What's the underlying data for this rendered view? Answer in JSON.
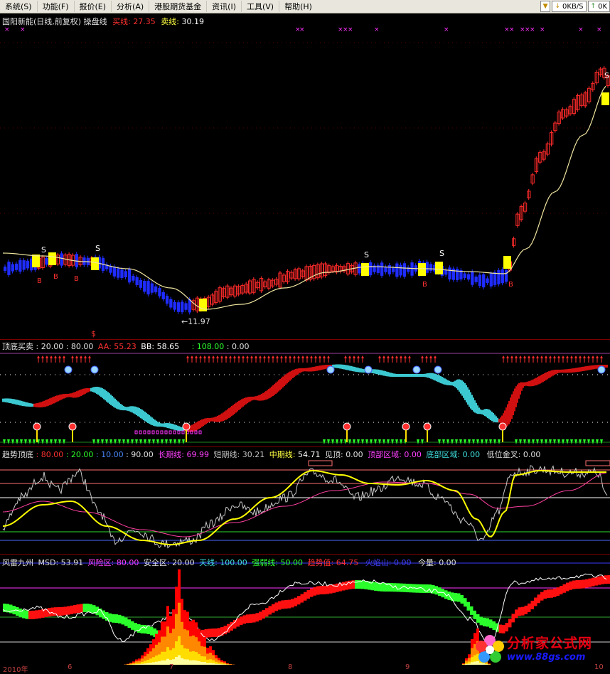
{
  "menu": {
    "items": [
      "系统(S)",
      "功能(F)",
      "报价(E)",
      "分析(A)",
      "港股期货基金",
      "资讯(I)",
      "工具(V)",
      "帮助(H)"
    ],
    "speed_up": "0KB/S",
    "speed_down": "0K",
    "tray_text": "↓"
  },
  "panel1": {
    "stock": "国阳新能(日线,前复权)",
    "indicator": "操盘线",
    "buy_label": "买线:",
    "buy_value": "27.35",
    "sell_label": "卖线:",
    "sell_value": "30.19",
    "low_marker": "←11.97",
    "s_mark": "S",
    "b_mark": "B",
    "cash_mark": "$"
  },
  "panel2": {
    "name": "顶底买卖",
    "v1": ": 20.00",
    "v2": ": 80.00",
    "aa_label": "AA:",
    "aa_value": "55.23",
    "bb_label": "BB:",
    "bb_value": "58.65",
    "v3": ": 108.00",
    "v4": ": 0.00"
  },
  "panel3": {
    "name": "趋势顶底",
    "v1": ": 80.00",
    "v2": ": 20.00",
    "v3": ": 10.00",
    "v4": ": 90.00",
    "long_label": "长期线:",
    "long_value": "69.99",
    "short_label": "短期线:",
    "short_value": "30.21",
    "mid_label": "中期线:",
    "mid_value": "54.71",
    "top_label": "见顶:",
    "top_value": "0.00",
    "topzone_label": "顶部区域:",
    "topzone_value": "0.00",
    "botzone_label": "底部区域:",
    "botzone_value": "0.00",
    "gold_label": "低位金叉:",
    "gold_value": "0.00"
  },
  "panel4": {
    "name": "风雷九州",
    "msd_label": "MSD:",
    "msd_value": "53.91",
    "risk_label": "风险区:",
    "risk_value": "80.00",
    "safe_label": "安全区:",
    "safe_value": "20.00",
    "sky_label": "天线:",
    "sky_value": "100.00",
    "strong_label": "强弱线:",
    "strong_value": "50.00",
    "trend_label": "趋势值:",
    "trend_value": "64.75",
    "fire_label": "火焰山:",
    "fire_value": "0.00",
    "vol_label": "今量:",
    "vol_value": "0.00"
  },
  "xaxis": [
    "2010年",
    "6",
    "7",
    "8",
    "9",
    "10"
  ],
  "watermark": {
    "text": "分析家公式网",
    "url": "www.88gs.com"
  },
  "colors": {
    "background": "#000000",
    "up_candle": "#ff2a2a",
    "down_candle": "#1f2cff",
    "signal_yellow": "#ffff00",
    "ma_line": "#f0e6a0",
    "cyan_band": "#3cc8d0",
    "red_band": "#d01010",
    "green": "#2bff2b",
    "magenta": "#ff33ff"
  }
}
